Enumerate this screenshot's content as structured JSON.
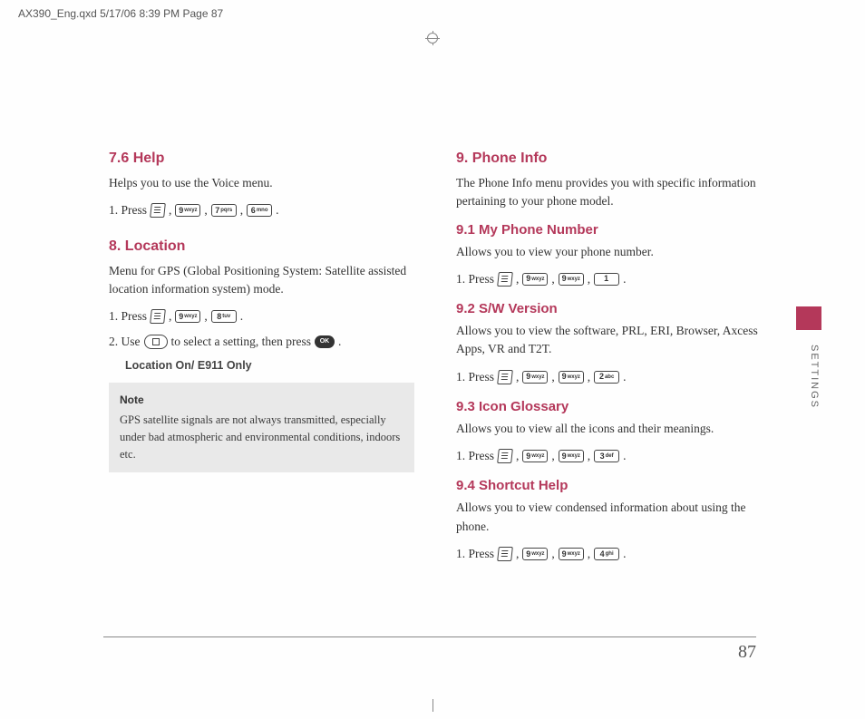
{
  "print_header": "AX390_Eng.qxd  5/17/06  8:39 PM  Page 87",
  "side_tab": "SETTINGS",
  "page_number": "87",
  "keys": {
    "k9": {
      "num": "9",
      "sub": "wxyz"
    },
    "k7": {
      "num": "7",
      "sub": "pqrs"
    },
    "k6": {
      "num": "6",
      "sub": "mno"
    },
    "k8": {
      "num": "8",
      "sub": "tuv"
    },
    "k1": {
      "num": "1",
      "sub": ""
    },
    "k2": {
      "num": "2",
      "sub": "abc"
    },
    "k3": {
      "num": "3",
      "sub": "def"
    },
    "k4": {
      "num": "4",
      "sub": "ghi"
    },
    "ok": "OK"
  },
  "left": {
    "s76": {
      "title": "7.6 Help",
      "body": "Helps you to use the Voice menu.",
      "step1_a": "1. Press",
      "comma": ",",
      "period": "."
    },
    "s8": {
      "title": "8. Location",
      "body": "Menu for GPS (Global Positioning System: Satellite assisted location information system) mode.",
      "step1_a": "1. Press",
      "step2_a": "2. Use",
      "step2_b": "to select a setting, then press",
      "indent": "Location On/ E911 Only",
      "note_title": "Note",
      "note_body": "GPS satellite signals are not always transmitted, especially under bad atmospheric and environmental conditions, indoors etc."
    }
  },
  "right": {
    "s9": {
      "title": "9. Phone Info",
      "body": "The Phone Info menu provides you with specific information pertaining to your phone model."
    },
    "s91": {
      "title": "9.1 My Phone Number",
      "body": "Allows you to view your phone number.",
      "step1_a": "1. Press"
    },
    "s92": {
      "title": "9.2 S/W Version",
      "body": "Allows you to view the software, PRL, ERI, Browser, Axcess Apps, VR and T2T.",
      "step1_a": "1. Press"
    },
    "s93": {
      "title": "9.3 Icon Glossary",
      "body": "Allows you to view all the icons and their meanings.",
      "step1_a": "1. Press"
    },
    "s94": {
      "title": "9.4 Shortcut Help",
      "body": "Allows you to view condensed information about using the phone.",
      "step1_a": "1. Press"
    }
  }
}
